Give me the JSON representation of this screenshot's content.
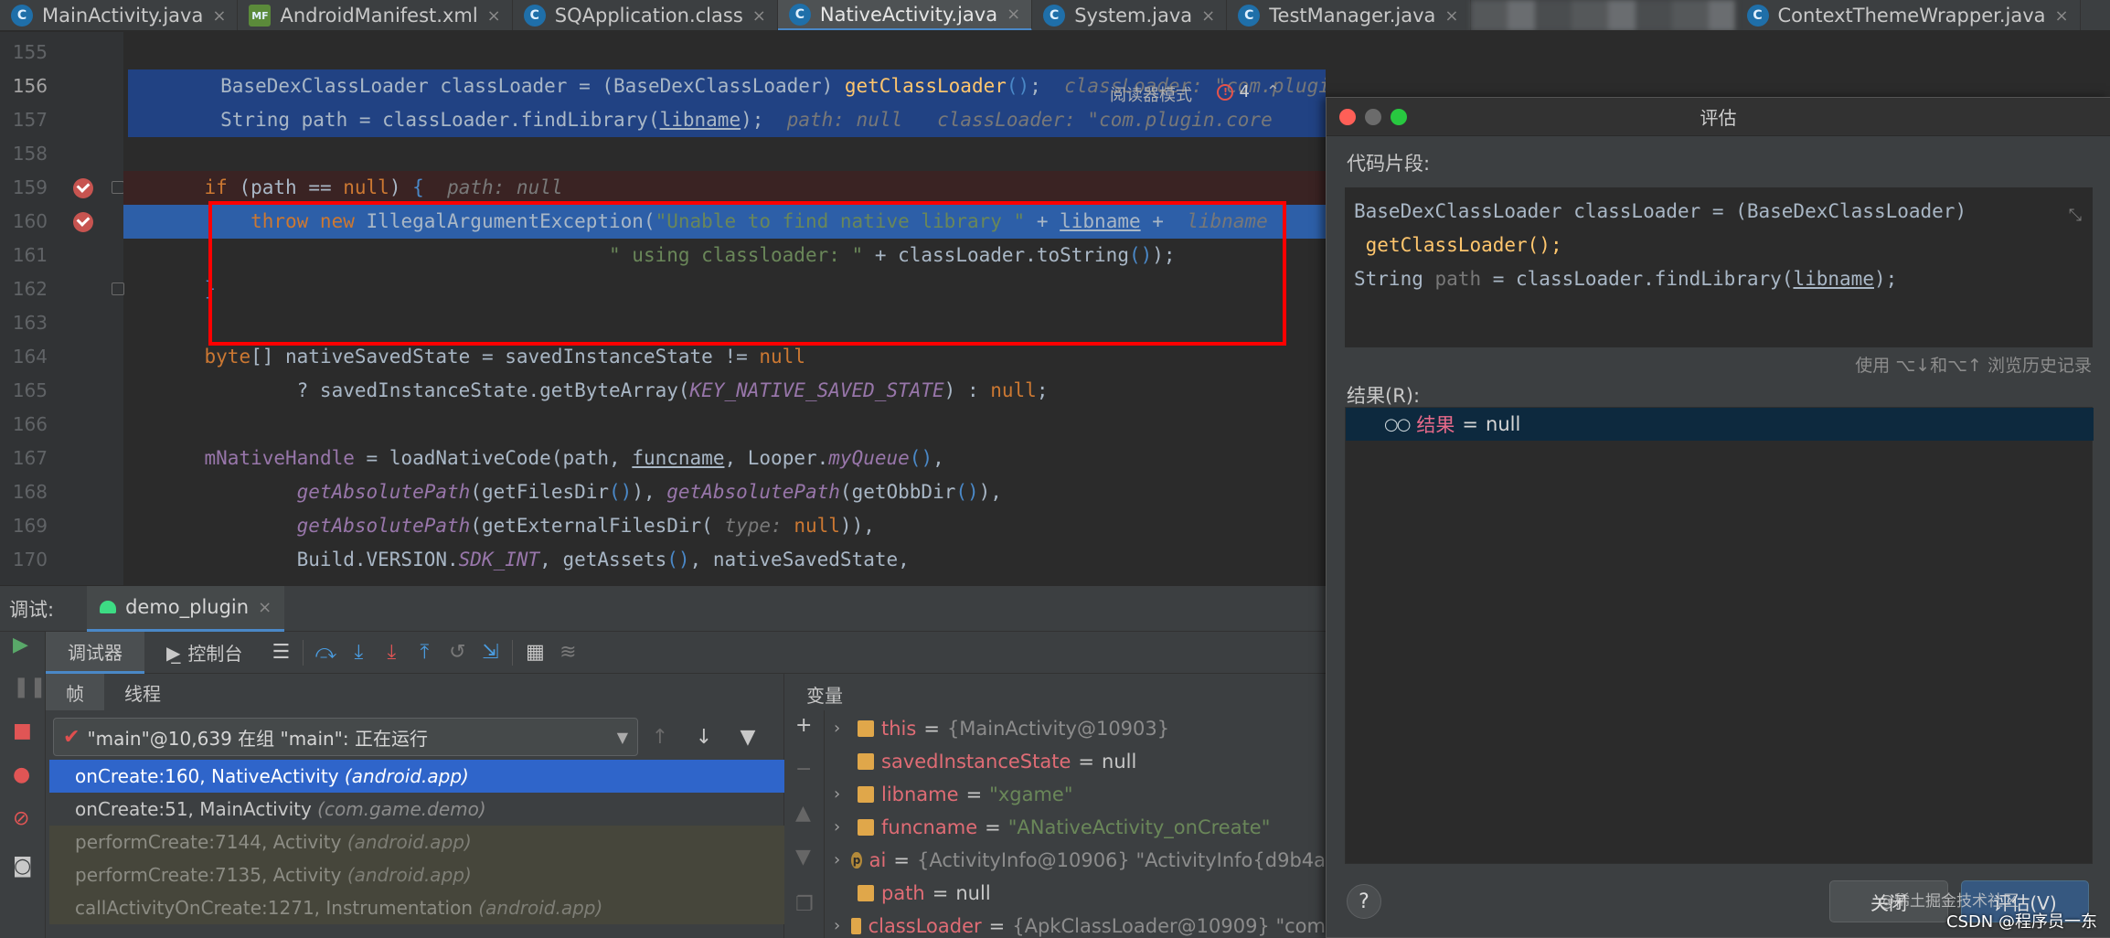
{
  "tabs": [
    {
      "label": "MainActivity.java",
      "icon": "C",
      "active": false
    },
    {
      "label": "AndroidManifest.xml",
      "icon": "MF",
      "active": false
    },
    {
      "label": "SQApplication.class",
      "icon": "C",
      "active": false
    },
    {
      "label": "NativeActivity.java",
      "icon": "C",
      "active": true
    },
    {
      "label": "System.java",
      "icon": "C",
      "active": false
    },
    {
      "label": "TestManager.java",
      "icon": "C",
      "active": false
    },
    {
      "label": "ContextThemeWrapper.java",
      "icon": "C",
      "active": false
    }
  ],
  "editor": {
    "reader_mode": "阅读器模式",
    "problem_count": "4",
    "line_numbers": [
      "155",
      "156",
      "157",
      "158",
      "159",
      "160",
      "161",
      "162",
      "163",
      "164",
      "165",
      "166",
      "167",
      "168",
      "169",
      "170"
    ],
    "inline": {
      "l156": "classLoader: \"com.plugin.core.loader.ApkClassLoader[DexPathList[[zip file \"/data/user/",
      "l157a": "path: null",
      "l157b": "classLoader: \"com.plugin.core",
      "l159": "path: null",
      "l160": "libname",
      "l169": "type:"
    }
  },
  "dialog": {
    "title": "评估",
    "snippet_label": "代码片段:",
    "snippet": {
      "line1a": "BaseDexClassLoader classLoader = (BaseDexClassLoader)",
      "line2": "getClassLoader();",
      "line3a": "String ",
      "line3b": "path",
      "line3c": " = classLoader.findLibrary(",
      "line3d": "libname",
      "line3e": ");"
    },
    "history_hint": "使用 ⌥↓和⌥↑ 浏览历史记录",
    "result_label": "结果(R):",
    "result": {
      "name": "结果",
      "eq": "=",
      "value": "null"
    },
    "help": "?",
    "close_button": "关闭",
    "evaluate_button": "评估(V)"
  },
  "debug": {
    "label": "调试:",
    "session": "demo_plugin",
    "tabs": {
      "debugger": "调试器",
      "console": "控制台"
    },
    "frames_tabs": {
      "frames": "帧",
      "threads": "线程"
    },
    "thread": "\"main\"@10,639 在组 \"main\": 正在运行",
    "frames": [
      {
        "method": "onCreate:160, NativeActivity ",
        "pkg": "(android.app)",
        "style": "sel"
      },
      {
        "method": "onCreate:51, MainActivity ",
        "pkg": "(com.game.demo)",
        "style": "normal"
      },
      {
        "method": "performCreate:7144, Activity ",
        "pkg": "(android.app)",
        "style": "lib"
      },
      {
        "method": "performCreate:7135, Activity ",
        "pkg": "(android.app)",
        "style": "lib"
      },
      {
        "method": "callActivityOnCreate:1271, Instrumentation ",
        "pkg": "(android.app)",
        "style": "lib"
      }
    ],
    "variables_title": "变量",
    "variables": [
      {
        "name": "this",
        "eq": " = ",
        "value": "{MainActivity@10903}",
        "kind": "obj",
        "expand": true,
        "icon": "field"
      },
      {
        "name": "savedInstanceState",
        "eq": " = ",
        "value": "null",
        "kind": "plain",
        "expand": false,
        "icon": "field"
      },
      {
        "name": "libname",
        "eq": " = ",
        "value": "\"xgame\"",
        "kind": "str",
        "expand": true,
        "icon": "field"
      },
      {
        "name": "funcname",
        "eq": " = ",
        "value": "\"ANativeActivity_onCreate\"",
        "kind": "str",
        "expand": true,
        "icon": "field"
      },
      {
        "name": "ai",
        "eq": " = ",
        "value": "{ActivityInfo@10906} \"ActivityInfo{d9b4a",
        "kind": "obj",
        "expand": true,
        "icon": "param"
      },
      {
        "name": "path",
        "eq": " = ",
        "value": "null",
        "kind": "plain",
        "expand": false,
        "icon": "field"
      },
      {
        "name": "classLoader",
        "eq": " = ",
        "value": "{ApkClassLoader@10909} \"com",
        "kind": "obj",
        "expand": true,
        "icon": "field"
      }
    ]
  },
  "watermark": "CSDN @程序员一东",
  "watermark2": "@稀土掘金技术社区"
}
